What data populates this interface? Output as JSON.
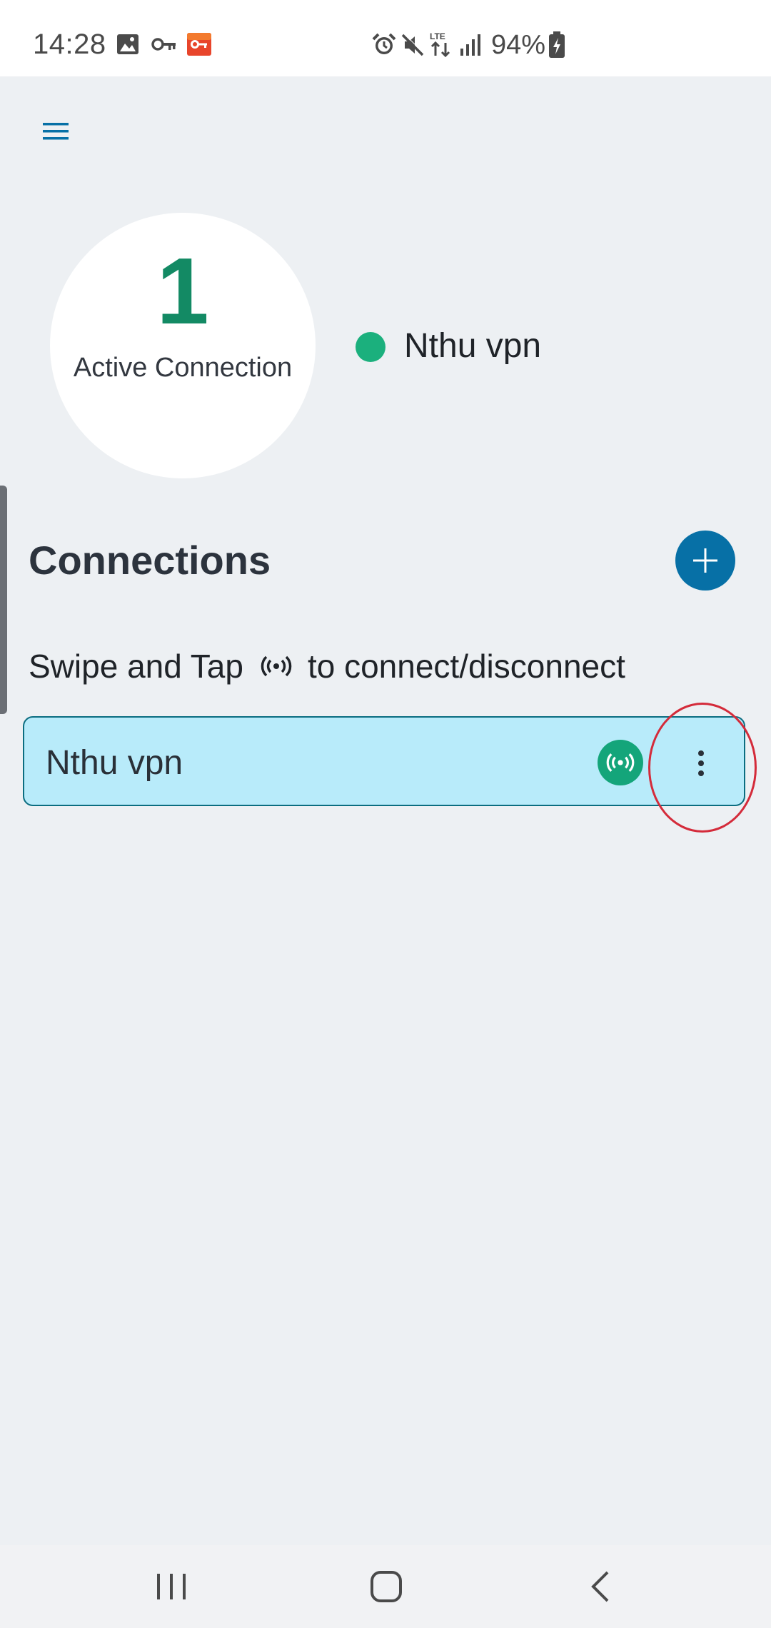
{
  "status_bar": {
    "time": "14:28",
    "battery": "94%",
    "icons": [
      "image-icon",
      "vpn-key-icon",
      "app-key-icon",
      "alarm-icon",
      "mute-icon",
      "lte-icon",
      "signal-icon",
      "battery-charging-icon"
    ],
    "colors": {
      "app_key_badge": "#e8452b"
    }
  },
  "app": {
    "colors": {
      "accent": "#0770a6",
      "active_green": "#138a64",
      "status_dot": "#1bb07d",
      "item_background": "#b8ebfa",
      "toggle_green": "#14a57a"
    },
    "menu_icon": "hamburger-menu-icon",
    "summary": {
      "count": "1",
      "label": "Active Connection",
      "active_name": "Nthu vpn"
    },
    "connections": {
      "title": "Connections",
      "add_icon": "plus-icon",
      "hint_before": "Swipe and Tap",
      "hint_after": "to connect/disconnect",
      "items": [
        {
          "name": "Nthu vpn",
          "toggle_icon": "broadcast-icon",
          "menu_icon": "more-vertical-icon"
        }
      ]
    }
  },
  "nav": {
    "buttons": [
      "recent-apps-icon",
      "home-icon",
      "back-icon"
    ]
  }
}
